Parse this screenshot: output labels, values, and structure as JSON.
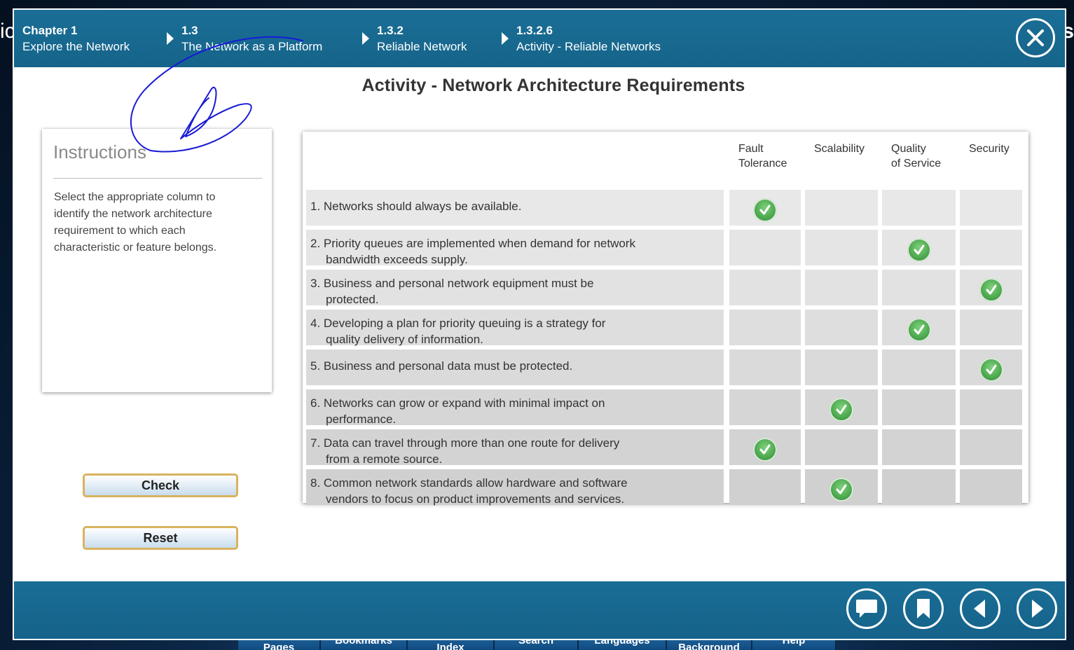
{
  "background": {
    "nav_items": [
      "Pages",
      "Bookmarks",
      "Index",
      "Search",
      "Languages",
      "Background",
      "Help"
    ],
    "edge_left": "ic",
    "edge_right": "s"
  },
  "header": {
    "breadcrumbs": [
      {
        "num": "Chapter 1",
        "label": "Explore the Network"
      },
      {
        "num": "1.3",
        "label": "The Network as a Platform"
      },
      {
        "num": "1.3.2",
        "label": "Reliable Network"
      },
      {
        "num": "1.3.2.6",
        "label": "Activity - Reliable Networks"
      }
    ],
    "close_icon": "close-icon"
  },
  "title": "Activity - Network Architecture Requirements",
  "instructions": {
    "heading": "Instructions",
    "text": "Select the appropriate column to identify the network architecture requirement to which each characteristic or feature belongs."
  },
  "buttons": {
    "check": "Check",
    "reset": "Reset"
  },
  "grid": {
    "columns": [
      {
        "line1": "Fault",
        "line2": "Tolerance"
      },
      {
        "line1": "Scalability",
        "line2": ""
      },
      {
        "line1": "Quality",
        "line2": "of Service"
      },
      {
        "line1": "Security",
        "line2": ""
      }
    ],
    "rows": [
      {
        "line1": "1. Networks should always be available.",
        "line2": "",
        "selected": 0
      },
      {
        "line1": "2. Priority queues are implemented when demand for network",
        "line2": "bandwidth exceeds supply.",
        "selected": 2
      },
      {
        "line1": "3. Business and personal network equipment must be",
        "line2": "protected.",
        "selected": 3
      },
      {
        "line1": "4. Developing a plan for priority queuing is a strategy for",
        "line2": "quality delivery of information.",
        "selected": 2
      },
      {
        "line1": "5. Business and personal data must be protected.",
        "line2": "",
        "selected": 3
      },
      {
        "line1": "6. Networks can grow or expand with minimal impact on",
        "line2": "performance.",
        "selected": 1
      },
      {
        "line1": "7. Data can travel through more than one route for delivery",
        "line2": "from a remote source.",
        "selected": 0
      },
      {
        "line1": "8. Common network standards allow hardware and software",
        "line2": "vendors to focus on product improvements and services.",
        "selected": 1
      }
    ],
    "check_icon": "checkmark-icon"
  },
  "footer": {
    "icons": [
      "comment-icon",
      "bookmark-icon",
      "previous-icon",
      "next-icon"
    ]
  },
  "colors": {
    "header_bg": "#1a6e96",
    "check_green": "#3f9d41",
    "button_border": "#d9b35f",
    "ink": "#1a1ad6"
  }
}
